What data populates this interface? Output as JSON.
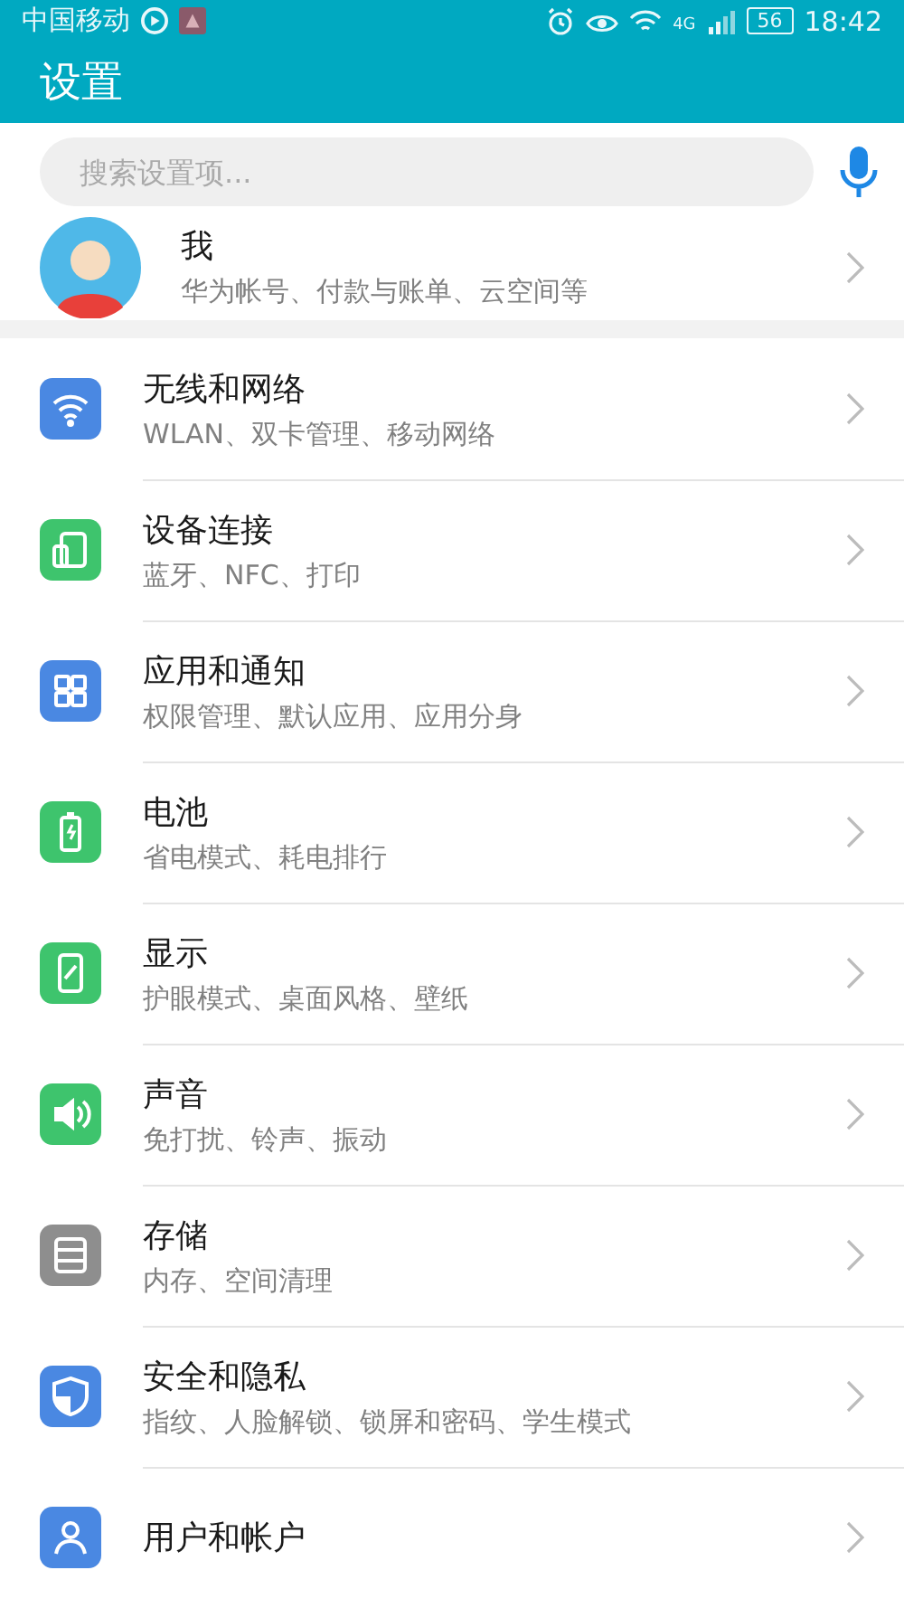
{
  "status_bar": {
    "carrier": "中国移动",
    "network": "4G",
    "battery": "56",
    "time": "18:42"
  },
  "title_bar": {
    "title": "设置"
  },
  "search": {
    "placeholder": "搜索设置项..."
  },
  "profile": {
    "name": "我",
    "subtitle": "华为帐号、付款与账单、云空间等"
  },
  "items": [
    {
      "kind": "wifi",
      "color": "#4a88e2",
      "title": "无线和网络",
      "subtitle": "WLAN、双卡管理、移动网络"
    },
    {
      "kind": "device",
      "color": "#3ec46d",
      "title": "设备连接",
      "subtitle": "蓝牙、NFC、打印"
    },
    {
      "kind": "apps",
      "color": "#4a88e2",
      "title": "应用和通知",
      "subtitle": "权限管理、默认应用、应用分身"
    },
    {
      "kind": "battery",
      "color": "#3ec46d",
      "title": "电池",
      "subtitle": "省电模式、耗电排行"
    },
    {
      "kind": "display",
      "color": "#3ec46d",
      "title": "显示",
      "subtitle": "护眼模式、桌面风格、壁纸"
    },
    {
      "kind": "sound",
      "color": "#3ec46d",
      "title": "声音",
      "subtitle": "免打扰、铃声、振动"
    },
    {
      "kind": "storage",
      "color": "#8e8e8e",
      "title": "存储",
      "subtitle": "内存、空间清理"
    },
    {
      "kind": "security",
      "color": "#4a88e2",
      "title": "安全和隐私",
      "subtitle": "指纹、人脸解锁、锁屏和密码、学生模式"
    },
    {
      "kind": "users",
      "color": "#4a88e2",
      "title": "用户和帐户"
    }
  ]
}
